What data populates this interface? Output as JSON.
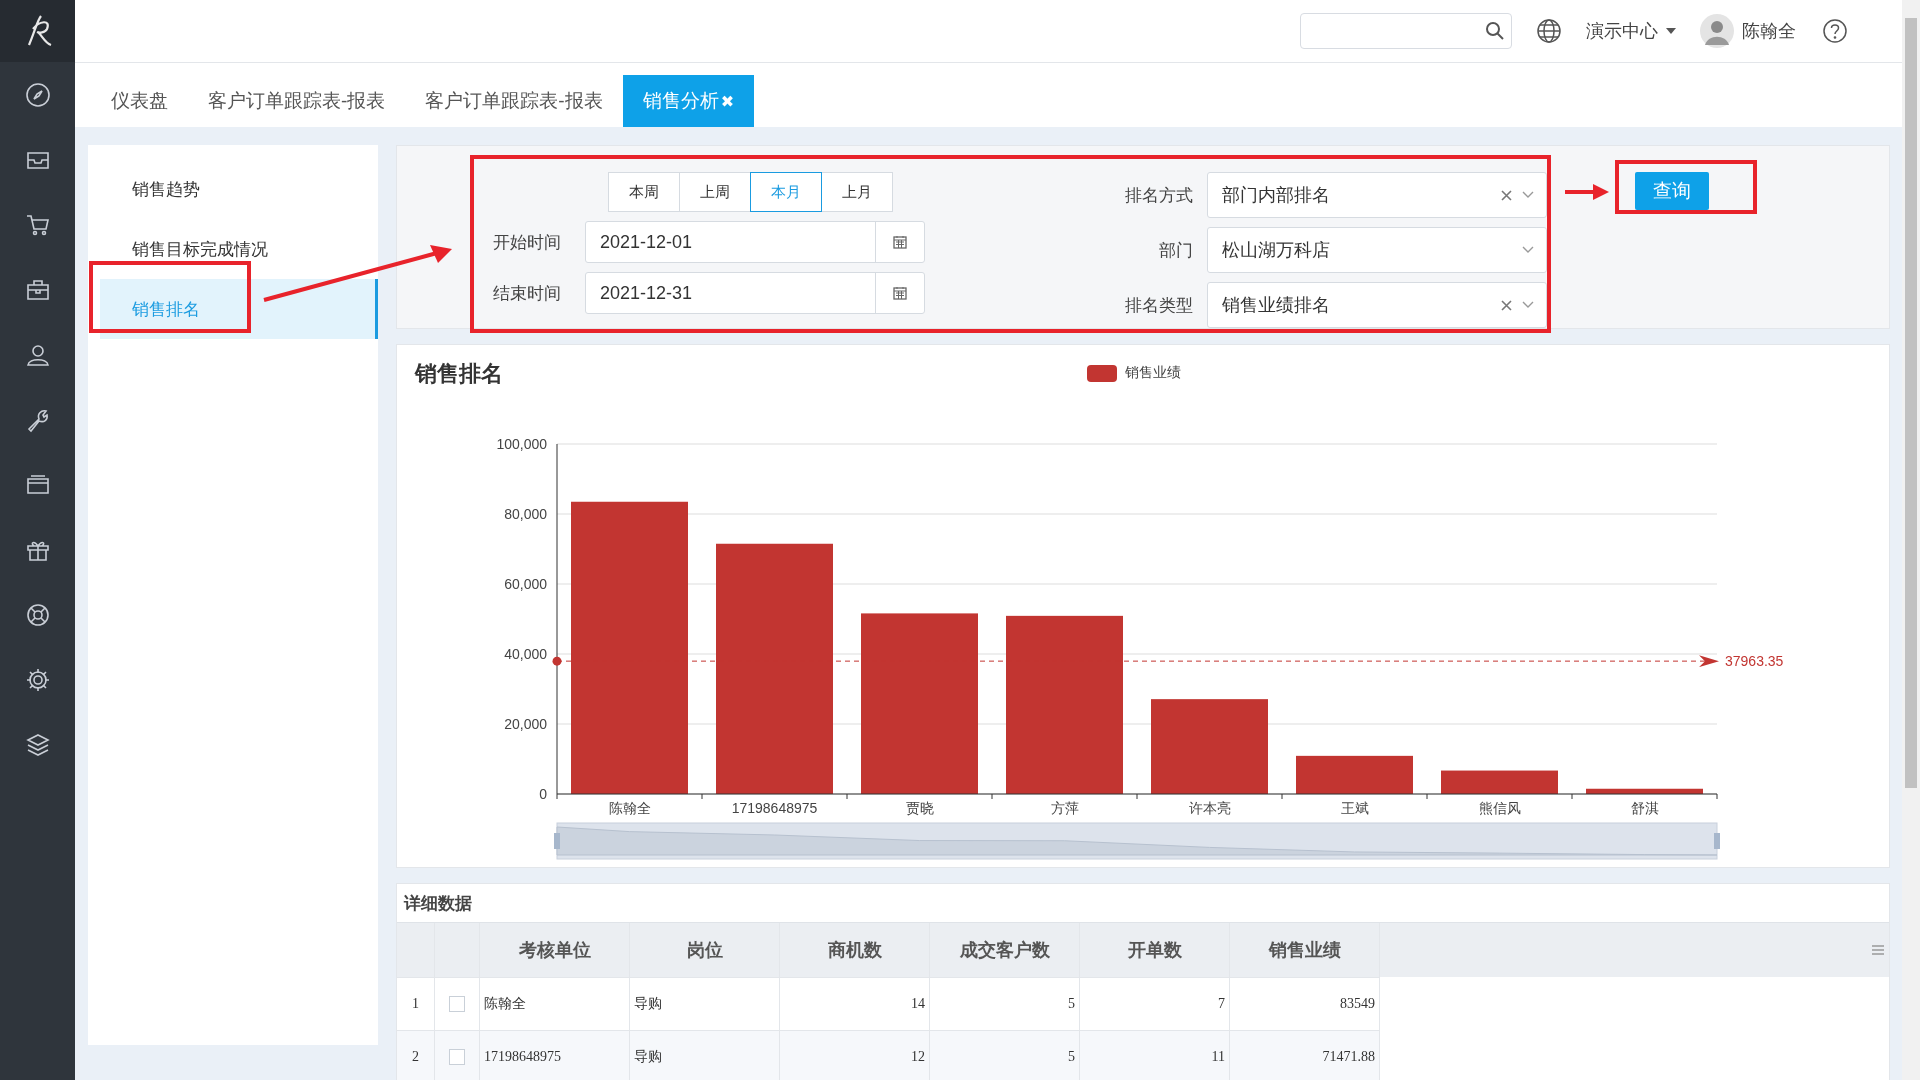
{
  "header": {
    "org": "演示中心",
    "user": "陈翰全"
  },
  "tabs": [
    {
      "label": "仪表盘",
      "selected": false
    },
    {
      "label": "客户订单跟踪表-报表",
      "selected": false
    },
    {
      "label": "客户订单跟踪表-报表",
      "selected": false
    },
    {
      "label": "销售分析",
      "selected": true,
      "close": "✖"
    }
  ],
  "menu": [
    {
      "label": "销售趋势",
      "selected": false
    },
    {
      "label": "销售目标完成情况",
      "selected": false
    },
    {
      "label": "销售排名",
      "selected": true
    }
  ],
  "filters": {
    "periods": [
      {
        "label": "本周",
        "selected": false
      },
      {
        "label": "上周",
        "selected": false
      },
      {
        "label": "本月",
        "selected": true
      },
      {
        "label": "上月",
        "selected": false
      }
    ],
    "dates": [
      {
        "label": "开始时间",
        "value": "2021-12-01"
      },
      {
        "label": "结束时间",
        "value": "2021-12-31"
      }
    ],
    "selects": [
      {
        "label": "排名方式",
        "value": "部门内部排名",
        "clearable": true
      },
      {
        "label": "部门",
        "value": "松山湖万科店",
        "clearable": false
      },
      {
        "label": "排名类型",
        "value": "销售业绩排名",
        "clearable": true
      }
    ],
    "query_button": "查询"
  },
  "chart": {
    "title": "销售排名",
    "chart_data": {
      "type": "bar",
      "categories": [
        "陈翰全",
        "17198648975",
        "贾晓",
        "方萍",
        "许本亮",
        "王斌",
        "熊信风",
        "舒淇"
      ],
      "series": [
        {
          "name": "销售业绩",
          "color": "#c23531",
          "values": [
            83500,
            71500,
            51600,
            50900,
            27100,
            10900,
            6700,
            1500
          ]
        }
      ],
      "grid": true,
      "ylim": [
        0,
        100000
      ],
      "yticks": [
        {
          "value": 0,
          "label": "0"
        },
        {
          "value": 20000,
          "label": "20,000"
        },
        {
          "value": 40000,
          "label": "40,000"
        },
        {
          "value": 60000,
          "label": "60,000"
        },
        {
          "value": 80000,
          "label": "80,000"
        },
        {
          "value": 100000,
          "label": "100,000"
        }
      ],
      "ref_lines": [
        {
          "axis": "y",
          "value": 37963.35,
          "label": "37963.35",
          "color": "#c23531"
        }
      ]
    }
  },
  "table": {
    "title": "详细数据",
    "columns": [
      "考核单位",
      "岗位",
      "商机数",
      "成交客户数",
      "开单数",
      "销售业绩"
    ],
    "rows": [
      {
        "index": "1",
        "checked": false,
        "cells": [
          "陈翰全",
          "导购",
          "14",
          "5",
          "7",
          "83549"
        ]
      },
      {
        "index": "2",
        "checked": false,
        "cells": [
          "17198648975",
          "导购",
          "12",
          "5",
          "11",
          "71471.88"
        ]
      }
    ]
  }
}
